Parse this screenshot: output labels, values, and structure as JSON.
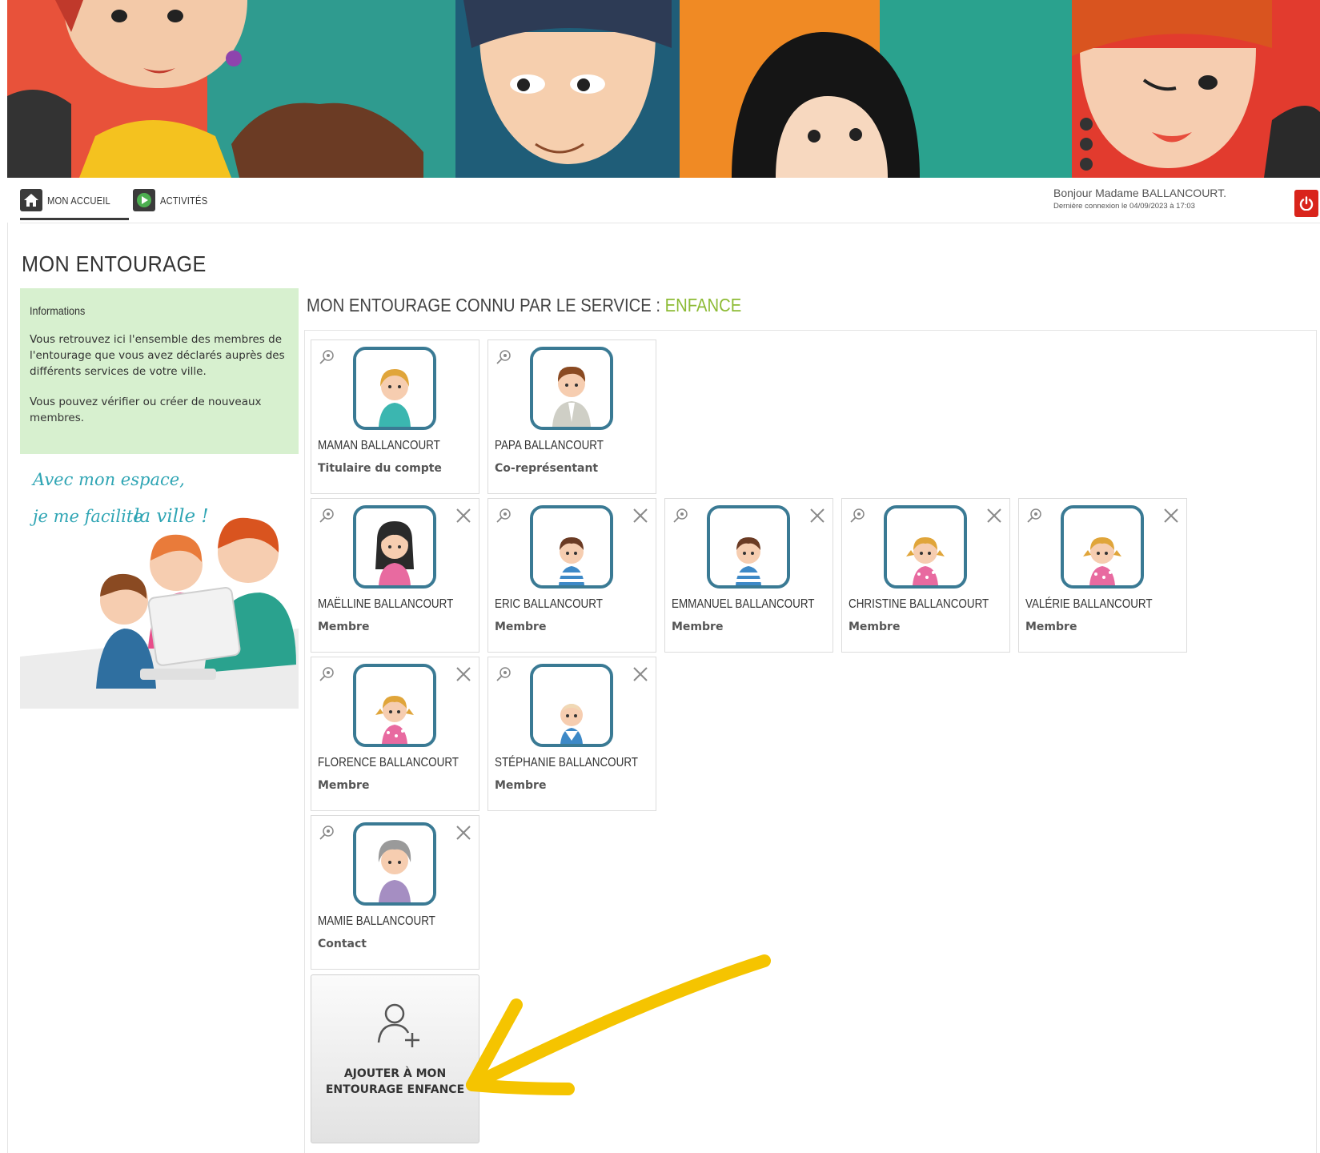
{
  "nav": {
    "items": [
      {
        "label": "MON ACCUEIL",
        "icon": "home-icon"
      },
      {
        "label": "ACTIVITÉS",
        "icon": "activities-icon"
      }
    ]
  },
  "user": {
    "greeting": "Bonjour Madame BALLANCOURT.",
    "last_login": "Dernière connexion le 04/09/2023 à 17:03"
  },
  "page": {
    "title": "MON ENTOURAGE"
  },
  "info": {
    "heading": "Informations",
    "paragraph1": "Vous retrouvez ici l'ensemble des membres de l'entourage que vous avez déclarés auprès des différents services de votre ville.",
    "paragraph2": "Vous pouvez vérifier ou créer de nouveaux membres."
  },
  "promo": {
    "line1": "Avec mon espace,",
    "line2a": "je me facilite",
    "line2b": "la ville !"
  },
  "section": {
    "title_prefix": "MON ENTOURAGE CONNU PAR LE SERVICE : ",
    "service": "ENFANCE"
  },
  "members": [
    {
      "name": "MAMAN BALLANCOURT",
      "role": "Titulaire du compte",
      "avatar": "woman-avatar"
    },
    {
      "name": "PAPA BALLANCOURT",
      "role": "Co-représentant",
      "avatar": "man-avatar"
    },
    {
      "name": "MAËLLINE BALLANCOURT",
      "role": "Membre",
      "avatar": "teen-girl-avatar"
    },
    {
      "name": "ERIC BALLANCOURT",
      "role": "Membre",
      "avatar": "boy-avatar"
    },
    {
      "name": "EMMANUEL BALLANCOURT",
      "role": "Membre",
      "avatar": "boy-avatar"
    },
    {
      "name": "CHRISTINE BALLANCOURT",
      "role": "Membre",
      "avatar": "girl-avatar"
    },
    {
      "name": "VALÉRIE BALLANCOURT",
      "role": "Membre",
      "avatar": "girl-avatar"
    },
    {
      "name": "FLORENCE BALLANCOURT",
      "role": "Membre",
      "avatar": "girl-avatar"
    },
    {
      "name": "STÉPHANIE BALLANCOURT",
      "role": "Membre",
      "avatar": "baby-avatar"
    },
    {
      "name": "MAMIE BALLANCOURT",
      "role": "Contact",
      "avatar": "grandma-avatar"
    }
  ],
  "add_button": {
    "line1": "AJOUTER À MON",
    "line2": "ENTOURAGE ENFANCE"
  },
  "colors": {
    "accent_green": "#8dbb35",
    "info_bg": "#d7f0cf",
    "avatar_border": "#3a7a94",
    "logout_red": "#d9241b",
    "annotation_yellow": "#f5c400"
  }
}
